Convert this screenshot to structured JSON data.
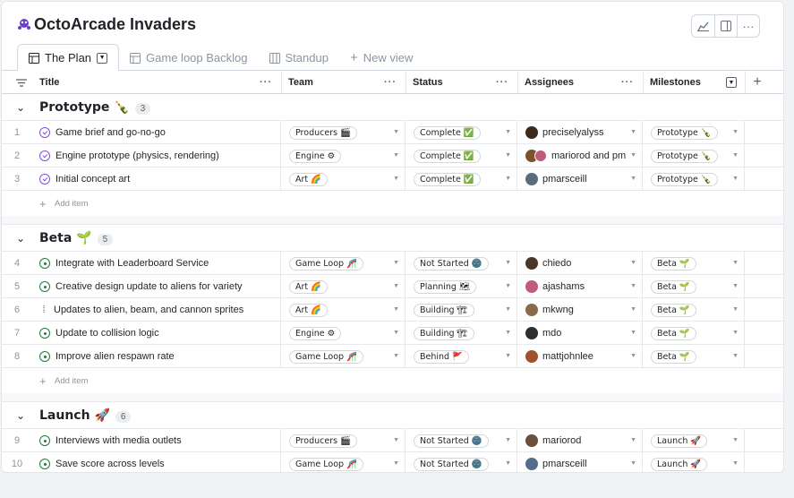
{
  "app": {
    "title": "OctoArcade Invaders",
    "colors": {
      "complete": "#8250df",
      "open": "#1a7f37",
      "border": "#d0d7de",
      "text": "#1f2328",
      "muted": "#8c959f"
    },
    "header_buttons": [
      "insights-icon",
      "side-panel-icon",
      "more-icon"
    ]
  },
  "tabs": [
    {
      "label": "The Plan",
      "icon": "table-icon",
      "active": true
    },
    {
      "label": "Game loop Backlog",
      "icon": "table-icon"
    },
    {
      "label": "Standup",
      "icon": "board-icon"
    },
    {
      "label": "New view",
      "icon": "plus-icon"
    }
  ],
  "columns": {
    "title": "Title",
    "team": "Team",
    "status": "Status",
    "assignees": "Assignees",
    "milestones": "Milestones"
  },
  "add_item_label": "Add item",
  "groups": [
    {
      "name": "Prototype 🍾",
      "count": "3",
      "items": [
        {
          "num": "1",
          "state": "done",
          "title": "Game brief and go-no-go",
          "team": "Producers 🎬",
          "status": "Complete ✅",
          "assignee": "preciselyalyss",
          "milestone": "Prototype 🍾"
        },
        {
          "num": "2",
          "state": "done",
          "title": "Engine prototype (physics, rendering)",
          "team": "Engine ⚙",
          "status": "Complete ✅",
          "assignee": "mariorod and pm",
          "milestone": "Prototype 🍾",
          "multi": true
        },
        {
          "num": "3",
          "state": "done",
          "title": "Initial concept art",
          "team": "Art 🌈",
          "status": "Complete ✅",
          "assignee": "pmarsceill",
          "milestone": "Prototype 🍾"
        }
      ]
    },
    {
      "name": "Beta 🌱",
      "count": "5",
      "items": [
        {
          "num": "4",
          "state": "open",
          "title": "Integrate with Leaderboard Service",
          "team": "Game Loop 🎢",
          "status": "Not Started 🌚",
          "assignee": "chiedo",
          "milestone": "Beta 🌱"
        },
        {
          "num": "5",
          "state": "open",
          "title": "Creative design update to aliens for variety",
          "team": "Art 🌈",
          "status": "Planning 🗺",
          "assignee": "ajashams",
          "milestone": "Beta 🌱"
        },
        {
          "num": "6",
          "state": "draft",
          "title": "Updates to alien, beam, and cannon sprites",
          "team": "Art 🌈",
          "status": "Building 🏗",
          "assignee": "mkwng",
          "milestone": "Beta 🌱"
        },
        {
          "num": "7",
          "state": "open",
          "title": "Update to collision logic",
          "team": "Engine ⚙",
          "status": "Building 🏗",
          "assignee": "mdo",
          "milestone": "Beta 🌱"
        },
        {
          "num": "8",
          "state": "open",
          "title": "Improve alien respawn rate",
          "team": "Game Loop 🎢",
          "status": "Behind 🚩",
          "assignee": "mattjohnlee",
          "milestone": "Beta 🌱"
        }
      ]
    },
    {
      "name": "Launch 🚀",
      "count": "6",
      "items": [
        {
          "num": "9",
          "state": "open",
          "title": "Interviews with media outlets",
          "team": "Producers 🎬",
          "status": "Not Started 🌚",
          "assignee": "mariorod",
          "milestone": "Launch 🚀"
        },
        {
          "num": "10",
          "state": "open",
          "title": "Save score across levels",
          "team": "Game Loop 🎢",
          "status": "Not Started 🌚",
          "assignee": "pmarsceill",
          "milestone": "Launch 🚀"
        }
      ]
    }
  ]
}
